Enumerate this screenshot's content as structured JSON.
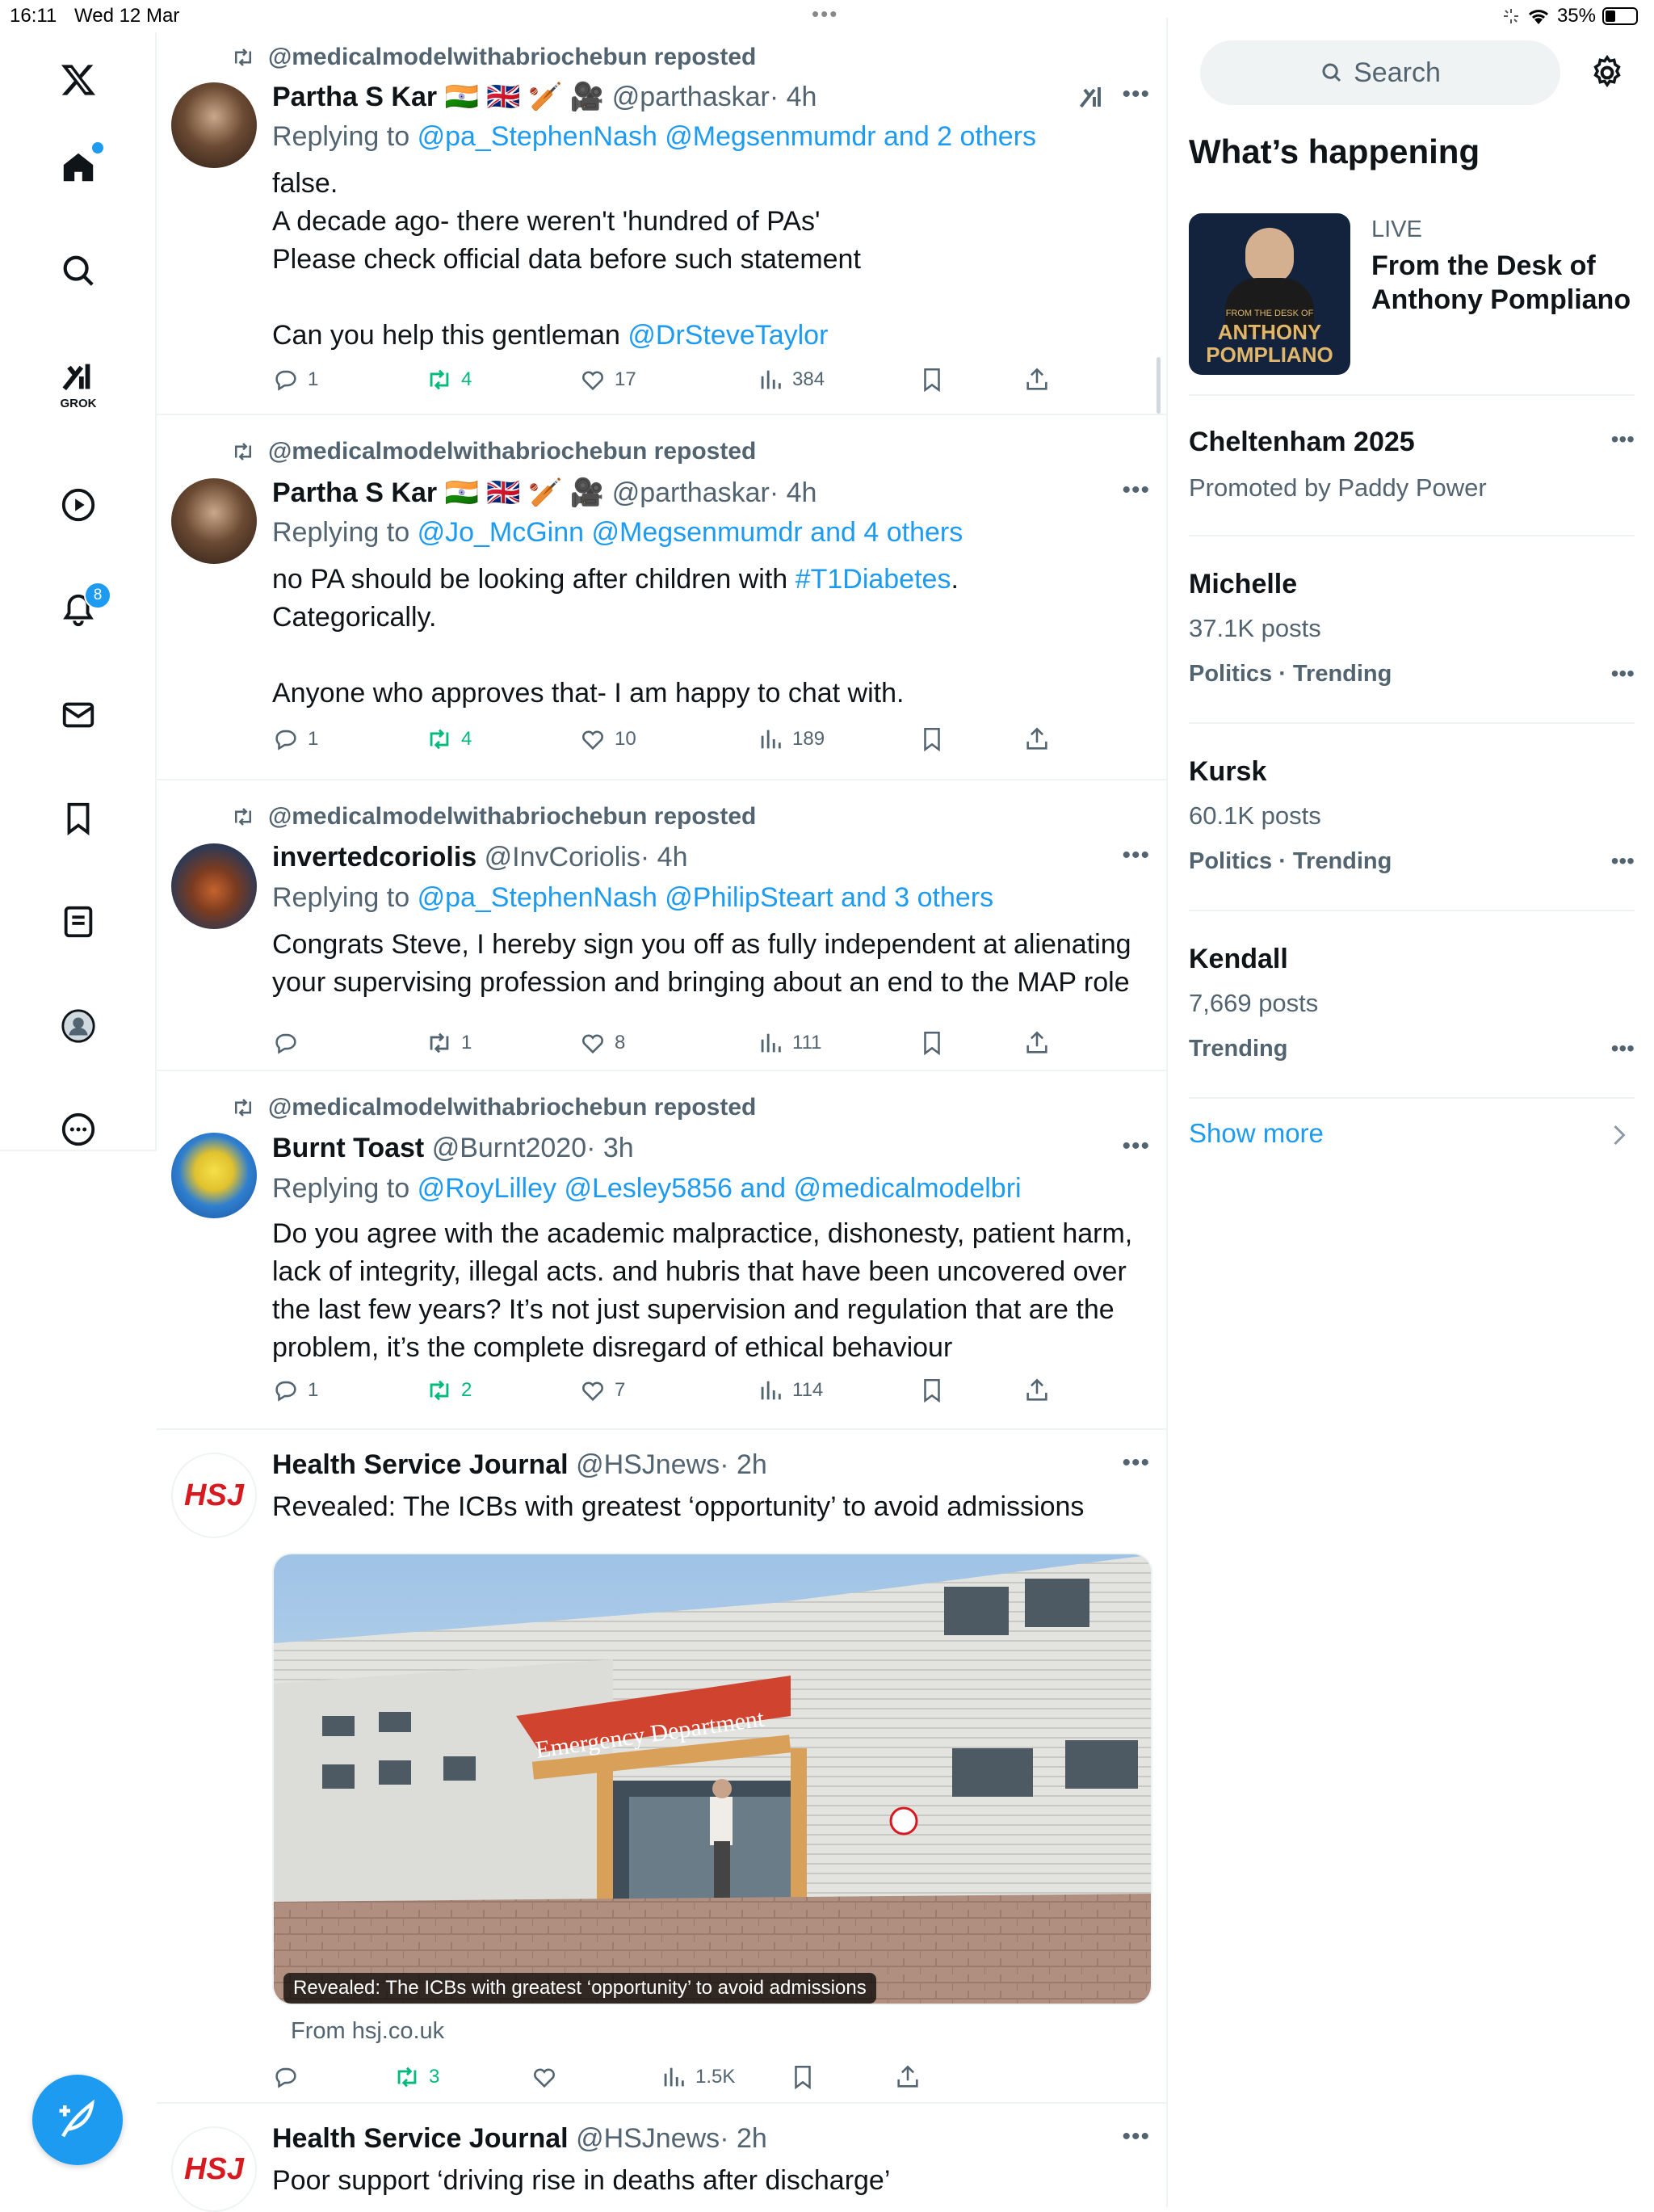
{
  "status": {
    "time": "16:11",
    "date": "Wed 12 Mar",
    "battery": "35%"
  },
  "nav": {
    "grok_label": "GROK",
    "notifications_badge": "8"
  },
  "search": {
    "placeholder": "Search"
  },
  "sidebar": {
    "heading": "What’s happening",
    "live": {
      "tag": "LIVE",
      "title_line1": "From the Desk of",
      "title_line2": "Anthony Pompliano",
      "thumb_line1": "FROM THE DESK OF",
      "thumb_line2": "ANTHONY",
      "thumb_line3": "POMPLIANO"
    },
    "promoted": {
      "title": "Cheltenham 2025",
      "sub": "Promoted by Paddy Power"
    },
    "trends": [
      {
        "title": "Michelle",
        "posts": "37.1K posts",
        "context": "Politics · Trending"
      },
      {
        "title": "Kursk",
        "posts": "60.1K posts",
        "context": "Politics · Trending"
      },
      {
        "title": "Kendall",
        "posts": "7,669 posts",
        "context": "Trending"
      }
    ],
    "show_more": "Show more"
  },
  "tweets": [
    {
      "repost": "@medicalmodelwithabriochebun reposted",
      "name": "Partha S Kar",
      "emojis": "🇮🇳 🇬🇧 🏏 🎥",
      "handle": "@parthaskar",
      "time": "· 4h",
      "reply_prefix": "Replying to",
      "reply_links": "@pa_StephenNash @Megsenmumdr and 2 others",
      "lines": [
        "false.",
        "A decade ago- there weren't 'hundred of PAs'",
        "Please check official data before such statement",
        "",
        "Can you help this gentleman "
      ],
      "tail_link": "@DrSteveTaylor",
      "replies": "1",
      "reposts": "4",
      "likes": "17",
      "views": "384"
    },
    {
      "repost": "@medicalmodelwithabriochebun reposted",
      "name": "Partha S Kar",
      "emojis": "🇮🇳 🇬🇧 🏏 🎥",
      "handle": "@parthaskar",
      "time": "· 4h",
      "reply_prefix": "Replying to",
      "reply_links": "@Jo_McGinn @Megsenmumdr and 4 others",
      "line1_pre": "no PA should be looking after children with ",
      "line1_link": "#T1Diabetes",
      "line1_post": ".",
      "line2": "Categorically.",
      "line4": "Anyone who approves that- I am happy to chat with.",
      "replies": "1",
      "reposts": "4",
      "likes": "10",
      "views": "189"
    },
    {
      "repost": "@medicalmodelwithabriochebun reposted",
      "name": "invertedcoriolis",
      "handle": "@InvCoriolis",
      "time": "· 4h",
      "reply_prefix": "Replying to",
      "reply_links": "@pa_StephenNash @PhilipSteart and 3 others",
      "text": "Congrats Steve, I hereby sign you off as fully independent at alienating your supervising profession and bringing about an end to the MAP role",
      "replies": "",
      "reposts": "1",
      "likes": "8",
      "views": "111"
    },
    {
      "repost": "@medicalmodelwithabriochebun reposted",
      "name": "Burnt Toast",
      "handle": "@Burnt2020",
      "time": "· 3h",
      "reply_prefix": "Replying to",
      "reply_links": "@RoyLilley @Lesley5856 and @medicalmodelbri",
      "text": "Do you agree with the academic malpractice, dishonesty, patient harm, lack of integrity, illegal acts. and hubris that have been uncovered over the last few years? It’s not just supervision and regulation that are the problem, it’s the complete disregard of ethical behaviour",
      "replies": "1",
      "reposts": "2",
      "likes": "7",
      "views": "114"
    },
    {
      "name": "Health Service Journal",
      "handle": "@HSJnews",
      "time": "· 2h",
      "avatar_text": "HSJ",
      "text": "Revealed: The ICBs with greatest ‘opportunity’ to avoid admissions",
      "card_caption": "Revealed: The ICBs with greatest ‘opportunity’ to avoid admissions",
      "card_sign": "Emergency Department",
      "card_source": "From hsj.co.uk",
      "replies": "",
      "reposts": "3",
      "likes": "",
      "views": "1.5K"
    },
    {
      "name": "Health Service Journal",
      "handle": "@HSJnews",
      "time": "· 2h",
      "avatar_text": "HSJ",
      "text": "Poor support ‘driving rise in deaths after discharge’"
    }
  ],
  "colors": {
    "accent": "#1d9bf0",
    "repost_green": "#00ba7c",
    "muted": "#536471",
    "hsj_red": "#d71920"
  }
}
